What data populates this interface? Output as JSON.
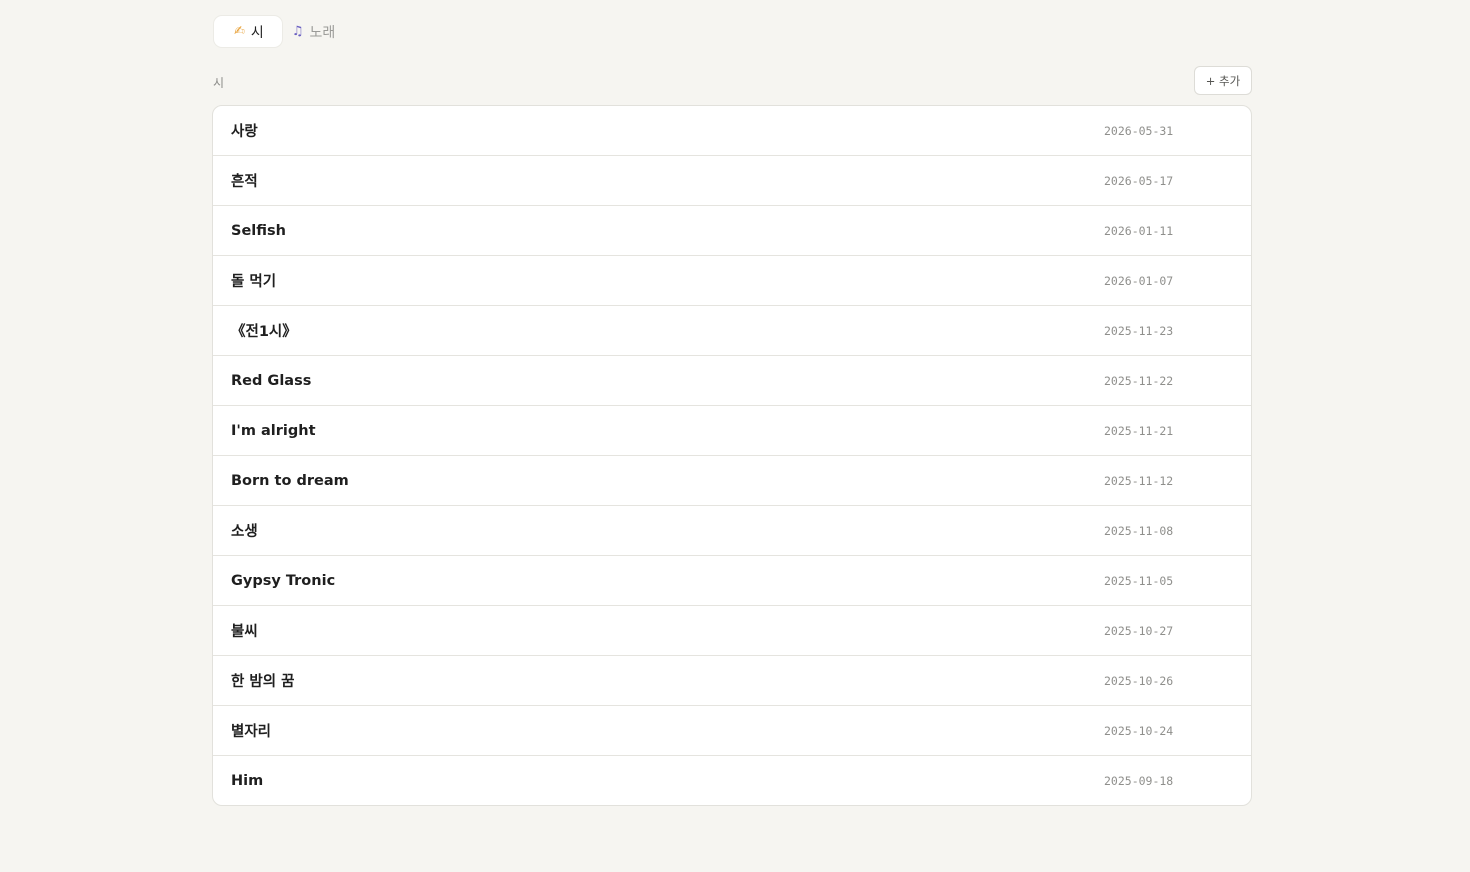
{
  "tabs": [
    {
      "icon": "✍",
      "label": "시",
      "active": true
    },
    {
      "icon": "♫",
      "label": "노래",
      "active": false
    }
  ],
  "section": {
    "label": "시",
    "add_label": "+ 추가"
  },
  "items": [
    {
      "title": "사랑",
      "date": "2026-05-31"
    },
    {
      "title": "흔적",
      "date": "2026-05-17"
    },
    {
      "title": "Selfish",
      "date": "2026-01-11"
    },
    {
      "title": "돌 먹기",
      "date": "2026-01-07"
    },
    {
      "title": "《전1시》",
      "date": "2025-11-23"
    },
    {
      "title": "Red Glass",
      "date": "2025-11-22"
    },
    {
      "title": "I'm alright",
      "date": "2025-11-21"
    },
    {
      "title": "Born to dream",
      "date": "2025-11-12"
    },
    {
      "title": "소생",
      "date": "2025-11-08"
    },
    {
      "title": "Gypsy Tronic",
      "date": "2025-11-05"
    },
    {
      "title": "불씨",
      "date": "2025-10-27"
    },
    {
      "title": "한 밤의 꿈",
      "date": "2025-10-26"
    },
    {
      "title": "별자리",
      "date": "2025-10-24"
    },
    {
      "title": "Him",
      "date": "2025-09-18"
    }
  ],
  "colors": {
    "background": "#f6f5f1",
    "card": "#ffffff",
    "border": "#e2e1dc",
    "muted_text": "#8f8f8c",
    "tab_icon_poem": "#e8a23a",
    "tab_icon_song": "#6a5fc1"
  }
}
